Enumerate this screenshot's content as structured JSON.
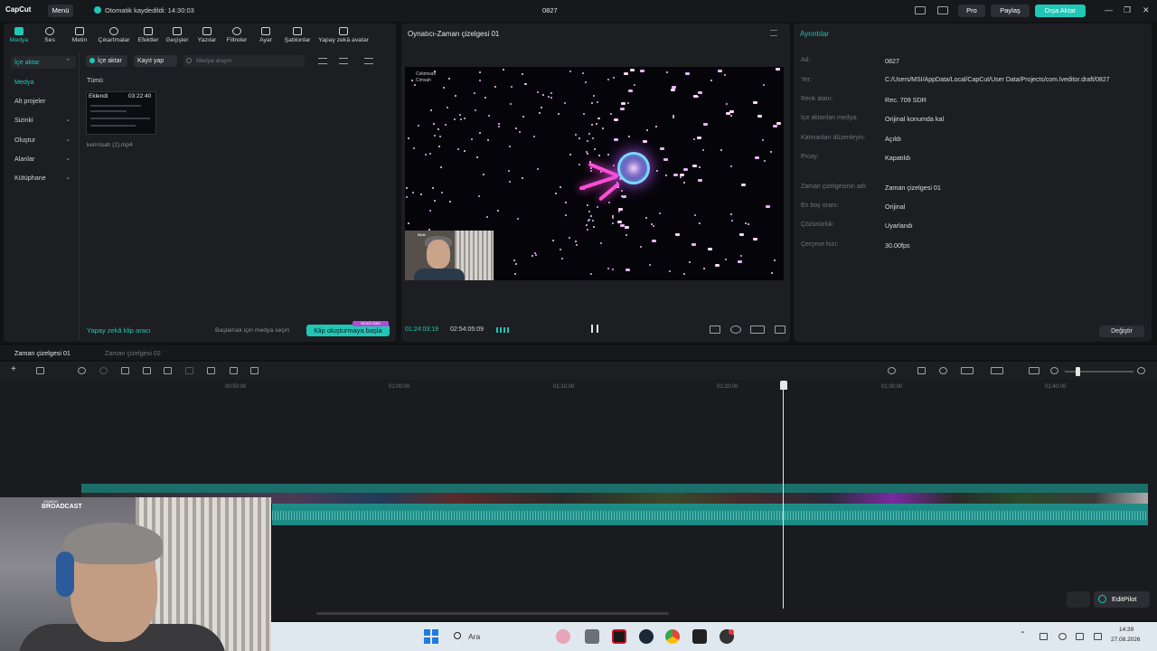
{
  "titlebar": {
    "logo": "CapCut",
    "menu": "Menü",
    "autosave": "Otomatik kaydedildi: 14:30:03",
    "project": "0827",
    "pro": "Pro",
    "share": "Paylaş",
    "export": "Dışa Aktar"
  },
  "tools": [
    "Medya",
    "Ses",
    "Metin",
    "Çıkartmalar",
    "Efektler",
    "Geçişler",
    "Yazılar",
    "Filtreler",
    "Ayar",
    "Şablonlar",
    "Yapay zekâ avatar"
  ],
  "sidenav": {
    "import": "İçe aktar",
    "media": "Medya",
    "subprojects": "Alt projeler",
    "yours": "Sizinki",
    "create": "Oluştur",
    "spaces": "Alanlar",
    "library": "Kütüphane"
  },
  "media": {
    "import_btn": "İçe aktar",
    "record_btn": "Kayıt yap",
    "search_placeholder": "Medya arayın",
    "all": "Tümü",
    "clip_added": "Eklendi",
    "clip_duration": "03:22:40",
    "clip_name": "kerimsah (2).mp4",
    "ai_clip": "Yapay zekâ klip aracı",
    "ai_hint": "Başlamak için medya seçin",
    "start_clip": "Klip oluşturmaya başla",
    "promo": "Sınırlı süre"
  },
  "player": {
    "title": "Oynatıcı-Zaman çizelgesi 01",
    "current_time": "01:24:03:19",
    "total_time": "02:54:05:09",
    "overlay_line1": "Cekimsah",
    "overlay_line2": "Cimsah",
    "webcam_tag": "Bildir"
  },
  "details": {
    "title": "Ayrıntılar",
    "rows": [
      {
        "label": "Ad:",
        "value": "0827"
      },
      {
        "label": "Yer:",
        "value": "C:/Users/MSI/AppData/Local/CapCut/User Data/Projects/com.lveditor.draft/0827"
      },
      {
        "label": "Renk alanı:",
        "value": "Rec. 709 SDR"
      },
      {
        "label": "İçe aktarılan medya:",
        "value": "Orijinal konumda kal"
      },
      {
        "label": "Katmanları düzenleyin:",
        "value": "Açıldı"
      },
      {
        "label": "Proxy:",
        "value": "Kapatıldı"
      },
      {
        "label": "Zaman çizelgesinin adı:",
        "value": "Zaman çizelgesi 01"
      },
      {
        "label": "En boy oranı:",
        "value": "Orijinal"
      },
      {
        "label": "Çözünürlük:",
        "value": "Uyarlandı"
      },
      {
        "label": "Çerçeve hızı:",
        "value": "30.00fps"
      }
    ],
    "change": "Değiştir"
  },
  "timeline": {
    "tab1": "Zaman çizelgesi 01",
    "tab2": "Zaman çizelgesi 02",
    "ticks": [
      "00:50:00",
      "01:00:00",
      "01:10:00",
      "01:20:00",
      "01:30:00",
      "01:40:00"
    ],
    "editpilot": "EditPilot"
  },
  "webcam": {
    "brand_small": "GAMING",
    "brand": "BROADCAST"
  },
  "taskbar": {
    "search": "Ara",
    "time": "14:39",
    "date": "27.08.2026"
  }
}
